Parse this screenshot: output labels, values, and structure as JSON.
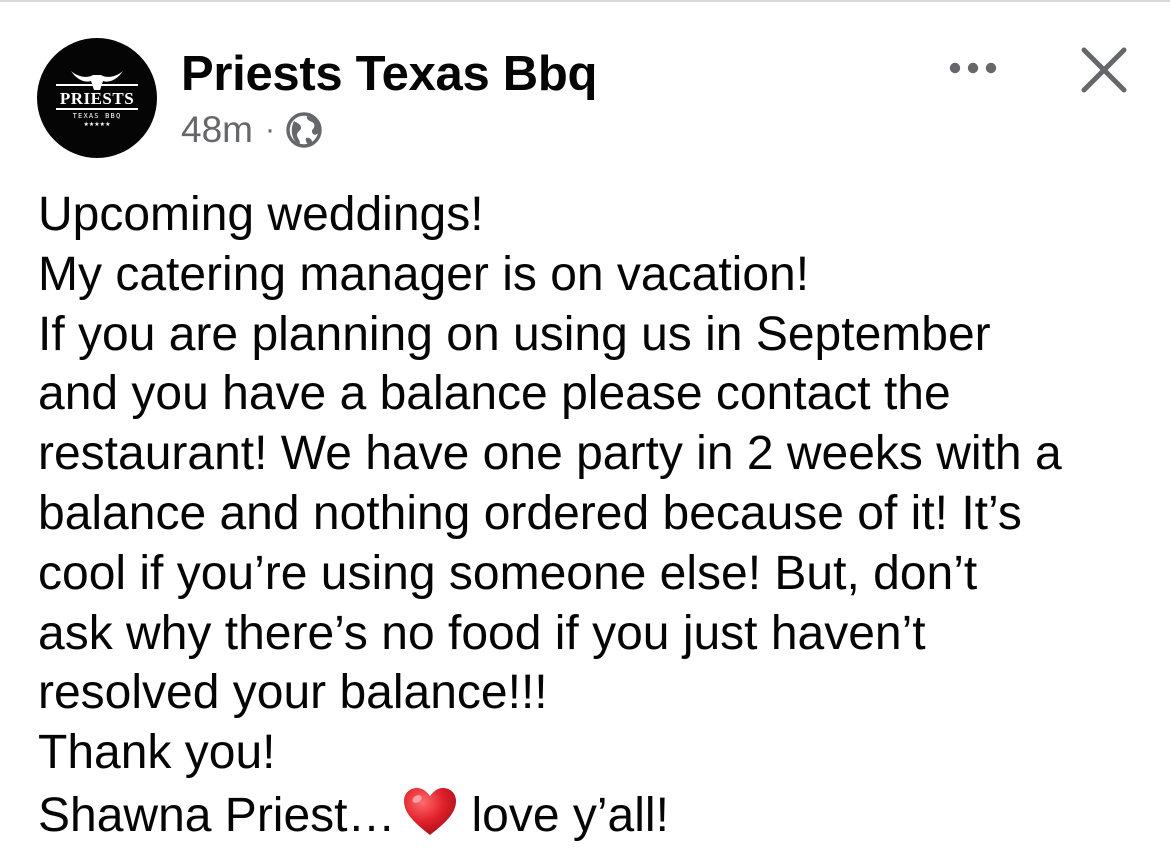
{
  "post": {
    "page_name": "Priests Texas Bbq",
    "timestamp": "48m",
    "separator": "·",
    "audience_icon": "globe-icon",
    "more_icon": "more-dots-icon",
    "close_icon": "close-icon",
    "avatar": {
      "brand_text": "PRIESTS",
      "sub_text": "TEXAS BBQ",
      "stars": "★★★★★"
    },
    "body_lines": [
      "Upcoming weddings!",
      "My catering manager is on vacation!",
      "If you are planning on using us in September",
      "and you have a balance please contact the",
      "restaurant! We have one party in 2 weeks with a",
      "balance and nothing ordered because of it! It’s",
      "cool if you’re using someone else! But, don’t",
      "ask why there’s no food if you just haven’t",
      "resolved your balance!!!",
      "Thank you!"
    ],
    "signoff_before": "Shawna Priest…",
    "signoff_emoji": "heart-icon",
    "signoff_after": "love y’all!"
  },
  "colors": {
    "text": "#050505",
    "secondary_text": "#65676b",
    "avatar_bg": "#050505",
    "heart": "#e0212b"
  }
}
